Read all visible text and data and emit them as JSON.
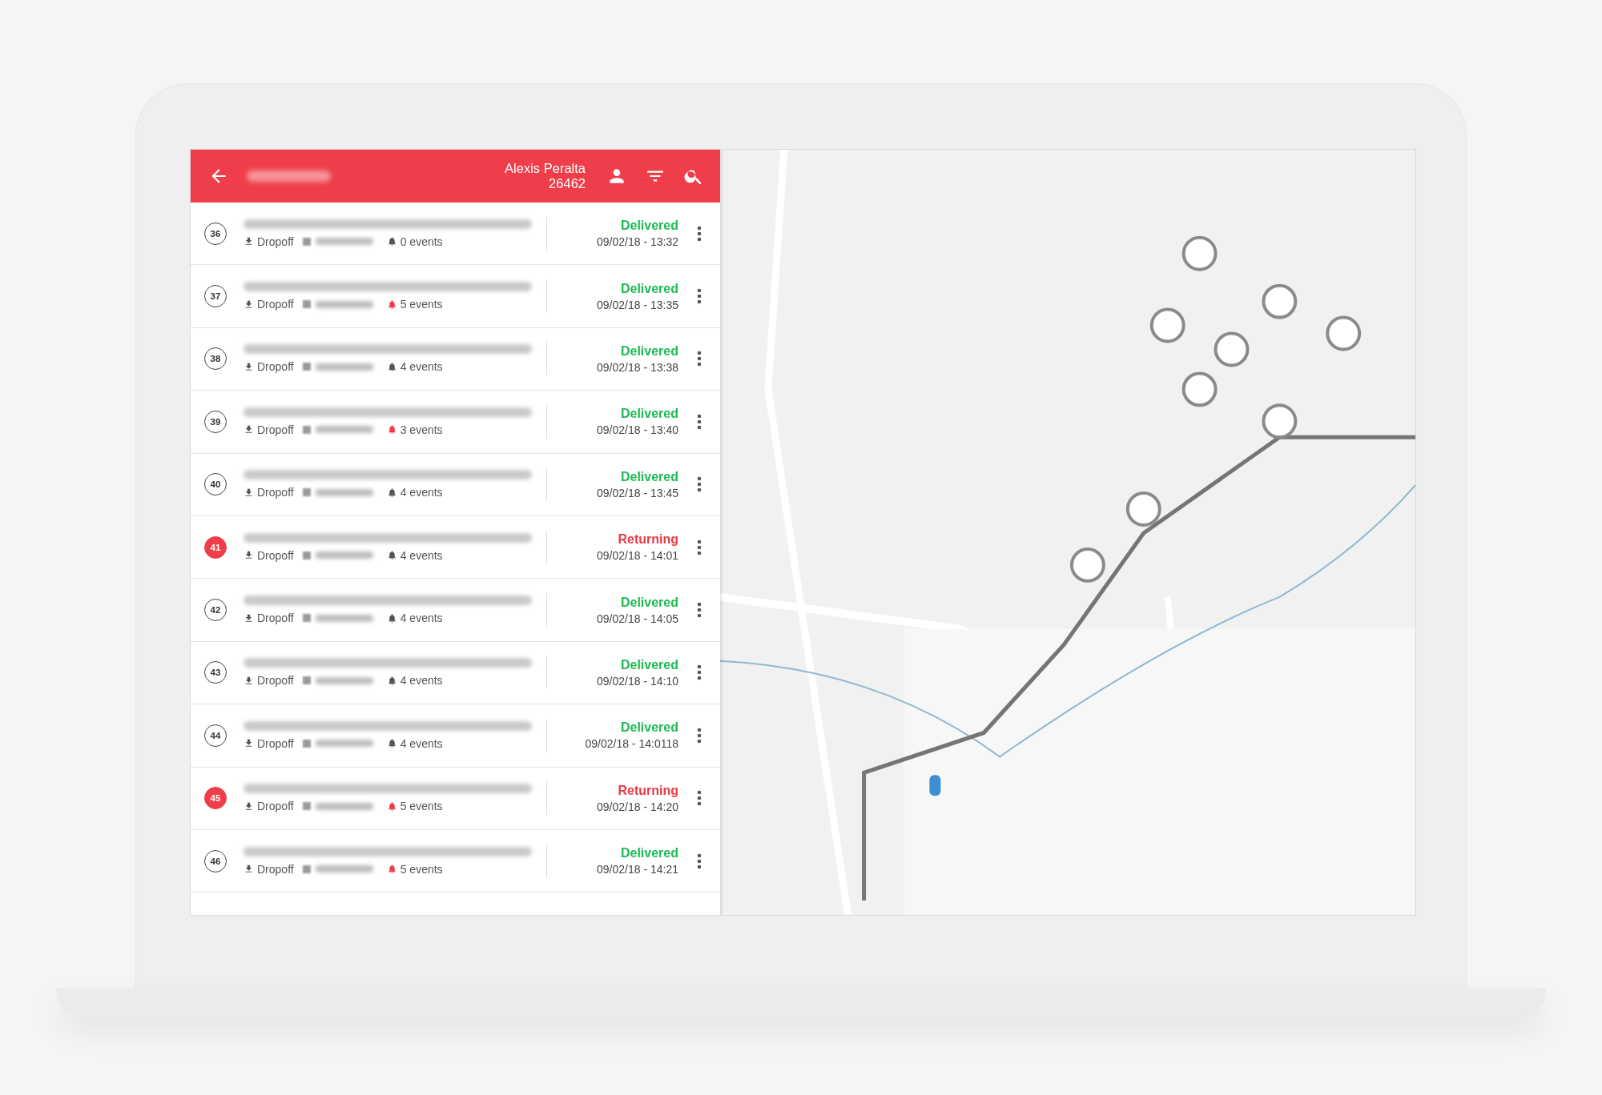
{
  "header": {
    "user_name": "Alexis Peralta",
    "user_id": "26462"
  },
  "stops": [
    {
      "number": "36",
      "status": "Delivered",
      "kind": "delivered",
      "time": "09/02/18 - 13:32",
      "type": "Dropoff",
      "events": "0 events",
      "events_alert": false
    },
    {
      "number": "37",
      "status": "Delivered",
      "kind": "delivered",
      "time": "09/02/18 - 13:35",
      "type": "Dropoff",
      "events": "5 events",
      "events_alert": true
    },
    {
      "number": "38",
      "status": "Delivered",
      "kind": "delivered",
      "time": "09/02/18 - 13:38",
      "type": "Dropoff",
      "events": "4 events",
      "events_alert": false
    },
    {
      "number": "39",
      "status": "Delivered",
      "kind": "delivered",
      "time": "09/02/18 - 13:40",
      "type": "Dropoff",
      "events": "3 events",
      "events_alert": true
    },
    {
      "number": "40",
      "status": "Delivered",
      "kind": "delivered",
      "time": "09/02/18 - 13:45",
      "type": "Dropoff",
      "events": "4 events",
      "events_alert": false
    },
    {
      "number": "41",
      "status": "Returning",
      "kind": "returning",
      "time": "09/02/18 - 14:01",
      "type": "Dropoff",
      "events": "4 events",
      "events_alert": false
    },
    {
      "number": "42",
      "status": "Delivered",
      "kind": "delivered",
      "time": "09/02/18 - 14:05",
      "type": "Dropoff",
      "events": "4 events",
      "events_alert": false
    },
    {
      "number": "43",
      "status": "Delivered",
      "kind": "delivered",
      "time": "09/02/18 - 14:10",
      "type": "Dropoff",
      "events": "4 events",
      "events_alert": false
    },
    {
      "number": "44",
      "status": "Delivered",
      "kind": "delivered",
      "time": "09/02/18 - 14:0118",
      "type": "Dropoff",
      "events": "4 events",
      "events_alert": false
    },
    {
      "number": "45",
      "status": "Returning",
      "kind": "returning",
      "time": "09/02/18 - 14:20",
      "type": "Dropoff",
      "events": "5 events",
      "events_alert": true
    },
    {
      "number": "46",
      "status": "Delivered",
      "kind": "delivered",
      "time": "09/02/18 - 14:21",
      "type": "Dropoff",
      "events": "5 events",
      "events_alert": true
    }
  ]
}
